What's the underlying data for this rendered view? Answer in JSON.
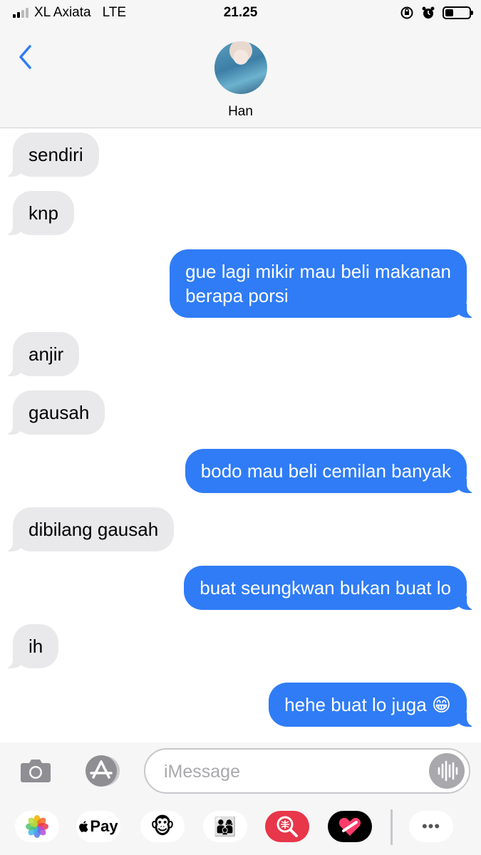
{
  "status_bar": {
    "carrier": "XL Axiata",
    "network": "LTE",
    "time": "21.25",
    "battery_level": 0.35
  },
  "header": {
    "contact_name": "Han",
    "back_icon": "chevron-left-icon",
    "accent_color": "#2f7cf6"
  },
  "messages": [
    {
      "direction": "in",
      "text": "sendiri"
    },
    {
      "direction": "in",
      "text": "knp"
    },
    {
      "direction": "out",
      "text": "gue lagi mikir mau beli makanan\nberapa porsi"
    },
    {
      "direction": "in",
      "text": "anjir"
    },
    {
      "direction": "in",
      "text": "gausah"
    },
    {
      "direction": "out",
      "text": "bodo mau beli cemilan banyak"
    },
    {
      "direction": "in",
      "text": "dibilang gausah"
    },
    {
      "direction": "out",
      "text": "buat seungkwan bukan buat lo"
    },
    {
      "direction": "in",
      "text": "ih"
    },
    {
      "direction": "out",
      "text": "hehe buat lo juga 😁"
    }
  ],
  "composer": {
    "placeholder": "iMessage",
    "value": "",
    "camera_icon": "camera-icon",
    "appstore_icon": "app-store-icon",
    "voice_icon": "waveform-icon"
  },
  "app_drawer": {
    "apps": [
      {
        "name": "photos-icon"
      },
      {
        "name": "apple-pay",
        "label": "Pay"
      },
      {
        "name": "monkey-emoji-icon",
        "label": "🐵"
      },
      {
        "name": "memoji-icon",
        "label": "👨‍👩‍👦"
      },
      {
        "name": "image-search-icon"
      },
      {
        "name": "digital-touch-icon"
      },
      {
        "name": "more-icon",
        "label": "•••"
      }
    ]
  },
  "colors": {
    "outgoing_bubble": "#2f7cf6",
    "incoming_bubble": "#e9e9eb",
    "bar_background": "#f6f6f6"
  }
}
